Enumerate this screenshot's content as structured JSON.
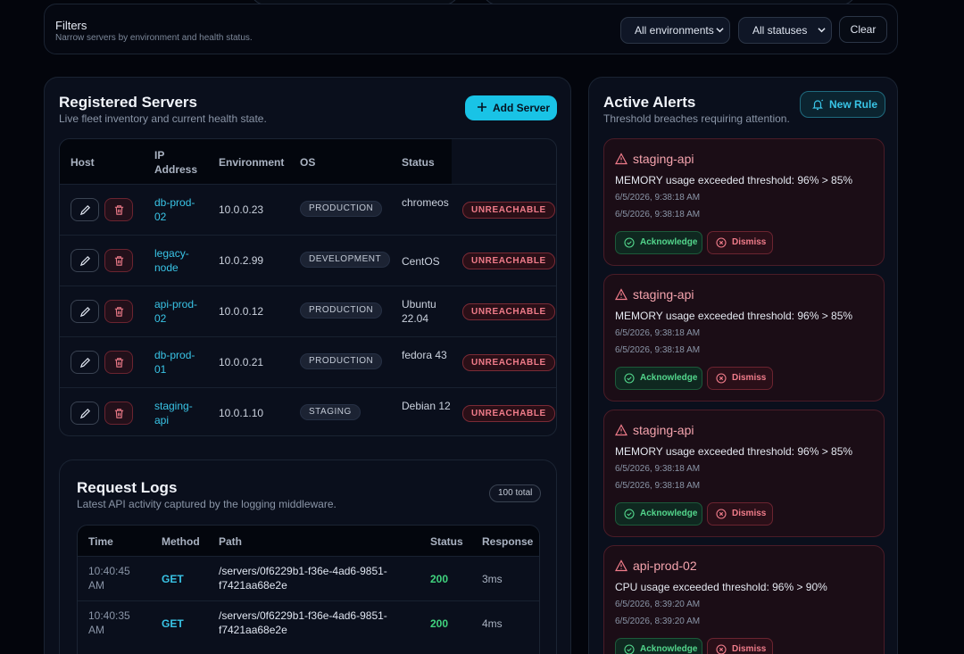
{
  "filters": {
    "title": "Filters",
    "subtitle": "Narrow servers by environment and health status.",
    "environment_select": "All environments",
    "status_select": "All statuses",
    "clear_label": "Clear"
  },
  "servers": {
    "title": "Registered Servers",
    "subtitle": "Live fleet inventory and current health state.",
    "add_label": "Add Server",
    "columns": [
      "Host",
      "IP Address",
      "Environment",
      "OS",
      "Status"
    ],
    "rows": [
      {
        "host": "db-prod-02",
        "ip": "10.0.0.23",
        "env": "PRODUCTION",
        "os": "chromeos",
        "status": "UNREACHABLE"
      },
      {
        "host": "legacy-node",
        "ip": "10.0.2.99",
        "env": "DEVELOPMENT",
        "os": "CentOS",
        "status": "UNREACHABLE"
      },
      {
        "host": "api-prod-02",
        "ip": "10.0.0.12",
        "env": "PRODUCTION",
        "os": "Ubuntu 22.04",
        "status": "UNREACHABLE"
      },
      {
        "host": "db-prod-01",
        "ip": "10.0.0.21",
        "env": "PRODUCTION",
        "os": "fedora 43",
        "status": "UNREACHABLE"
      },
      {
        "host": "staging-api",
        "ip": "10.0.1.10",
        "env": "STAGING",
        "os": "Debian 12",
        "status": "UNREACHABLE"
      }
    ]
  },
  "logs": {
    "title": "Request Logs",
    "subtitle": "Latest API activity captured by the logging middleware.",
    "total_badge": "100 total",
    "columns": [
      "Time",
      "Method",
      "Path",
      "Status",
      "Response"
    ],
    "rows": [
      {
        "time": "10:40:45 AM",
        "method": "GET",
        "path": "/servers/0f6229b1-f36e-4ad6-9851-f7421aa68e2e",
        "status": "200",
        "response": "3ms"
      },
      {
        "time": "10:40:35 AM",
        "method": "GET",
        "path": "/servers/0f6229b1-f36e-4ad6-9851-f7421aa68e2e",
        "status": "200",
        "response": "4ms"
      }
    ]
  },
  "alerts": {
    "title": "Active Alerts",
    "subtitle": "Threshold breaches requiring attention.",
    "new_rule_label": "New Rule",
    "acknowledge_label": "Acknowledge",
    "dismiss_label": "Dismiss",
    "items": [
      {
        "host": "staging-api",
        "message": "MEMORY usage exceeded threshold: 96% > 85%",
        "ts1": "6/5/2026, 9:38:18 AM",
        "ts2": "6/5/2026, 9:38:18 AM"
      },
      {
        "host": "staging-api",
        "message": "MEMORY usage exceeded threshold: 96% > 85%",
        "ts1": "6/5/2026, 9:38:18 AM",
        "ts2": "6/5/2026, 9:38:18 AM"
      },
      {
        "host": "staging-api",
        "message": "MEMORY usage exceeded threshold: 96% > 85%",
        "ts1": "6/5/2026, 9:38:18 AM",
        "ts2": "6/5/2026, 9:38:18 AM"
      },
      {
        "host": "api-prod-02",
        "message": "CPU usage exceeded threshold: 96% > 90%",
        "ts1": "6/5/2026, 8:39:20 AM",
        "ts2": "6/5/2026, 8:39:20 AM"
      }
    ]
  },
  "colors": {
    "accent": "#19c3e6",
    "danger": "#f07c8a",
    "success": "#53d68c",
    "background": "#03050c"
  }
}
